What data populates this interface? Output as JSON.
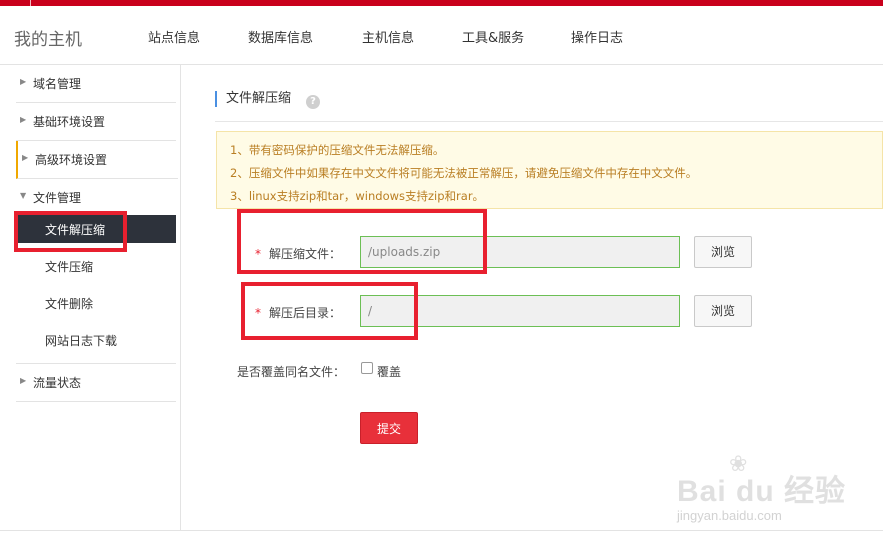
{
  "header": {
    "brand": "我的主机",
    "nav": [
      "站点信息",
      "数据库信息",
      "主机信息",
      "工具&服务",
      "操作日志"
    ]
  },
  "sidebar": {
    "groups": [
      {
        "label": "域名管理",
        "arrow": "▶"
      },
      {
        "label": "基础环境设置",
        "arrow": "▶"
      },
      {
        "label": "高级环境设置",
        "arrow": "▶"
      },
      {
        "label": "文件管理",
        "arrow": "▼"
      }
    ],
    "sub_items": [
      "文件解压缩",
      "文件压缩",
      "文件删除",
      "网站日志下载"
    ],
    "active_sub": "文件解压缩",
    "last_group": {
      "label": "流量状态",
      "arrow": "▶"
    }
  },
  "main": {
    "title": "文件解压缩",
    "help_icon": "?",
    "notice": [
      "1、带有密码保护的压缩文件无法解压缩。",
      "2、压缩文件中如果存在中文文件将可能无法被正常解压，请避免压缩文件中存在中文文件。",
      "3、linux支持zip和tar，windows支持zip和rar。"
    ],
    "form": {
      "required_mark": "*",
      "archive_label": "解压缩文件：",
      "archive_value": "/uploads.zip",
      "target_label": "解压后目录：",
      "target_value": "/",
      "browse_label": "浏览",
      "overwrite_question": "是否覆盖同名文件：",
      "overwrite_option": "覆盖",
      "overwrite_checked": false,
      "submit_label": "提交"
    }
  },
  "watermark": {
    "logo": "Bai  du 经验",
    "url": "jingyan.baidu.com"
  },
  "colors": {
    "brand_red": "#c9001c",
    "annotation_red": "#e8202f",
    "active_bg": "#2d323b",
    "input_border": "#6cbf55",
    "notice_bg": "#fffbe6",
    "notice_text": "#b97e23"
  }
}
